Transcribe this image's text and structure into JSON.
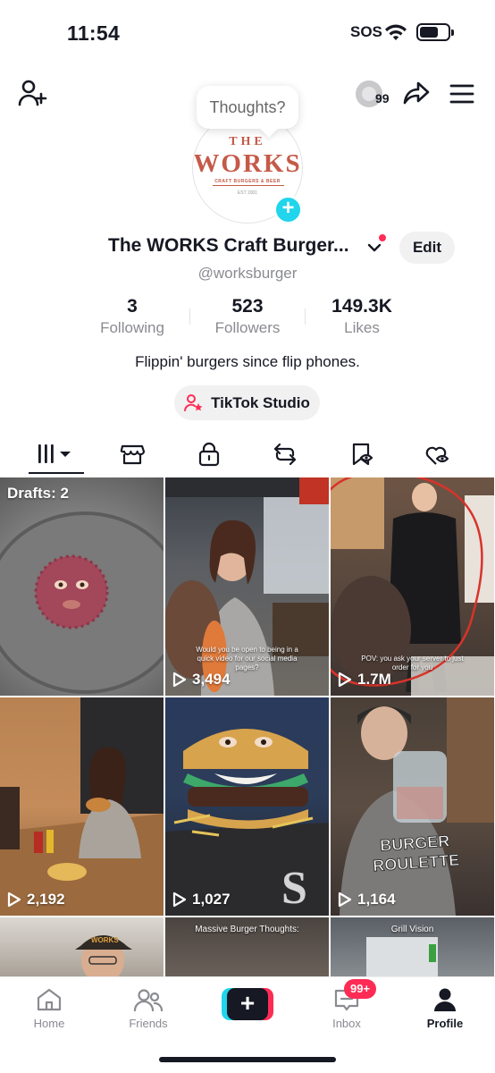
{
  "status_bar": {
    "time": "11:54",
    "sos": "SOS"
  },
  "header": {
    "coins": "99",
    "thoughts_bubble": "Thoughts?"
  },
  "avatar": {
    "logo_the": "THE",
    "logo_works": "WORKS",
    "logo_sub": "CRAFT BURGERS & BEER",
    "logo_est": "EST 2001"
  },
  "profile": {
    "name": "The WORKS Craft Burger...",
    "handle": "@worksburger",
    "edit_label": "Edit",
    "bio": "Flippin' burgers since flip phones.",
    "studio_label": "TikTok Studio"
  },
  "stats": [
    {
      "value": "3",
      "label": "Following"
    },
    {
      "value": "523",
      "label": "Followers"
    },
    {
      "value": "149.3K",
      "label": "Likes"
    }
  ],
  "videos": [
    {
      "drafts": "Drafts: 2",
      "views": "",
      "caption": "",
      "top_caption": "",
      "overlay": ""
    },
    {
      "drafts": "",
      "views": "3,494",
      "caption": "Would you be open to being in a quick video for our social media pages?",
      "top_caption": "",
      "overlay": ""
    },
    {
      "drafts": "",
      "views": "1.7M",
      "caption": "POV: you ask your server to just order for you",
      "top_caption": "",
      "overlay": ""
    },
    {
      "drafts": "",
      "views": "2,192",
      "caption": "",
      "top_caption": "",
      "overlay": ""
    },
    {
      "drafts": "",
      "views": "1,027",
      "caption": "",
      "top_caption": "",
      "overlay": ""
    },
    {
      "drafts": "",
      "views": "1,164",
      "caption": "",
      "top_caption": "",
      "overlay": "BURGER ROULETTE"
    },
    {
      "drafts": "",
      "views": "",
      "caption": "",
      "top_caption": "",
      "overlay": ""
    },
    {
      "drafts": "",
      "views": "",
      "caption": "",
      "top_caption": "Massive Burger Thoughts:",
      "overlay": ""
    },
    {
      "drafts": "",
      "views": "",
      "caption": "",
      "top_caption": "Grill Vision",
      "overlay": ""
    }
  ],
  "bottom_nav": {
    "home": "Home",
    "friends": "Friends",
    "inbox": "Inbox",
    "inbox_badge": "99+",
    "profile": "Profile"
  },
  "colors": {
    "accent_pink": "#fe2c55",
    "accent_cyan": "#20d5ec",
    "text_dark": "#161823",
    "text_gray": "#8a8b91",
    "logo_red": "#c55a48"
  }
}
